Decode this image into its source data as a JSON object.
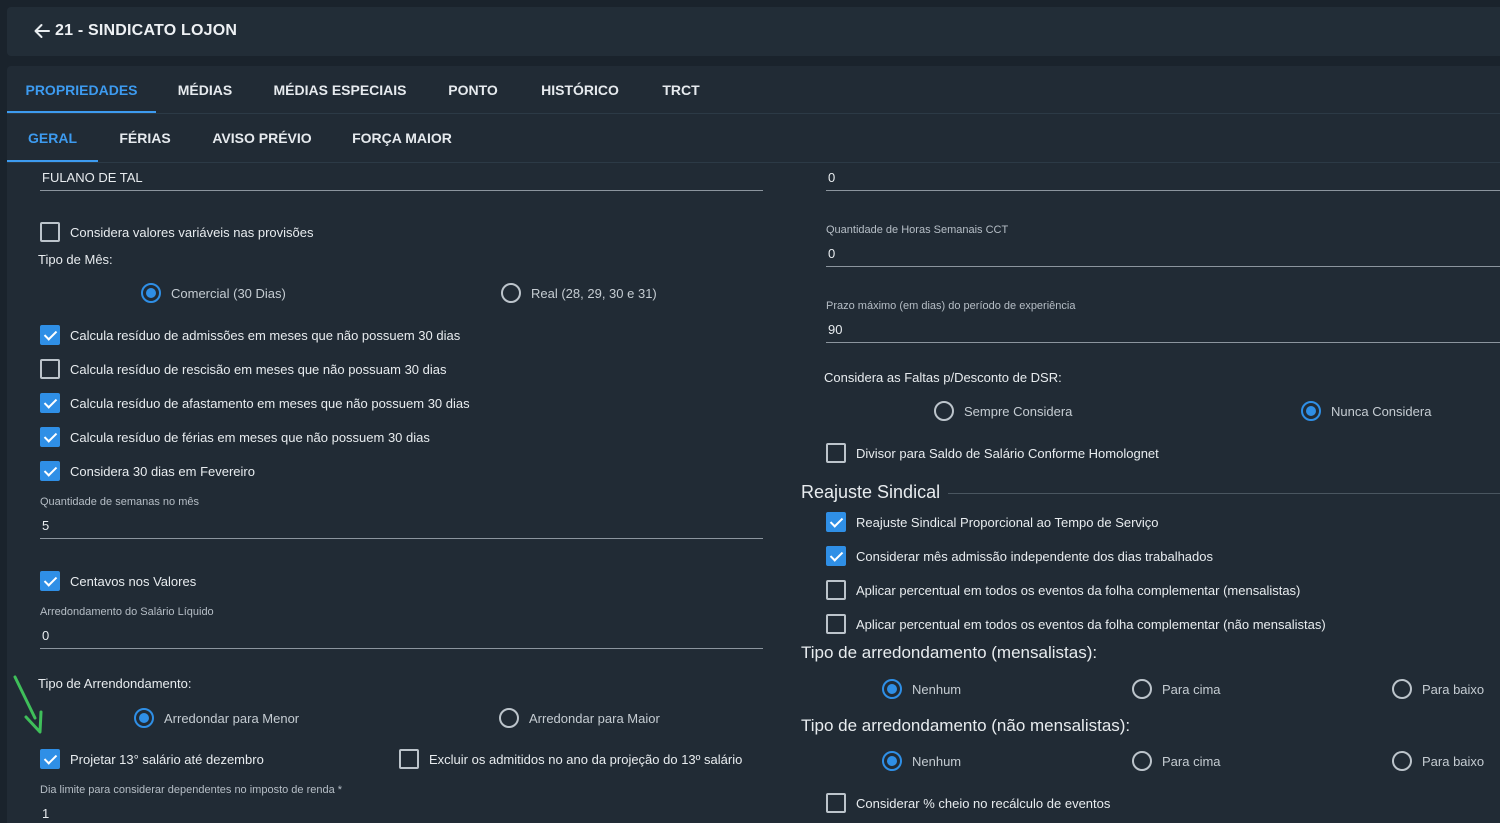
{
  "header": {
    "title": "21 - SINDICATO LOJON",
    "back_icon": "arrow-left-icon"
  },
  "tabs_primary": [
    {
      "label": "PROPRIEDADES",
      "active": true
    },
    {
      "label": "MÉDIAS",
      "active": false
    },
    {
      "label": "MÉDIAS ESPECIAIS",
      "active": false
    },
    {
      "label": "PONTO",
      "active": false
    },
    {
      "label": "HISTÓRICO",
      "active": false
    },
    {
      "label": "TRCT",
      "active": false
    }
  ],
  "tabs_secondary": [
    {
      "label": "GERAL",
      "active": true
    },
    {
      "label": "FÉRIAS",
      "active": false
    },
    {
      "label": "AVISO PRÉVIO",
      "active": false
    },
    {
      "label": "FORÇA MAIOR",
      "active": false
    }
  ],
  "left": {
    "name_field": {
      "value": "FULANO DE TAL"
    },
    "considera_variaveis": {
      "label": "Considera valores variáveis nas provisões",
      "checked": false
    },
    "tipo_mes": {
      "label": "Tipo de Mês:",
      "options": [
        {
          "label": "Comercial (30 Dias)",
          "selected": true
        },
        {
          "label": "Real (28, 29, 30 e 31)",
          "selected": false
        }
      ]
    },
    "residuo_admissoes": {
      "label": "Calcula resíduo de admissões em meses que não possuem 30 dias",
      "checked": true
    },
    "residuo_rescisao": {
      "label": "Calcula resíduo de rescisão em meses que não possuam 30 dias",
      "checked": false
    },
    "residuo_afastamento": {
      "label": "Calcula resíduo de afastamento em meses que não possuem 30 dias",
      "checked": true
    },
    "residuo_ferias": {
      "label": "Calcula resíduo de férias em meses que não possuem 30 dias",
      "checked": true
    },
    "considera_fevereiro": {
      "label": "Considera 30 dias em Fevereiro",
      "checked": true
    },
    "semanas_mes": {
      "label": "Quantidade de semanas no mês",
      "value": "5"
    },
    "centavos": {
      "label": "Centavos nos Valores",
      "checked": true
    },
    "arredondamento_salario": {
      "label": "Arredondamento do Salário Líquido",
      "value": "0"
    },
    "tipo_arredondamento": {
      "label": "Tipo de Arrendondamento:",
      "options": [
        {
          "label": "Arredondar para Menor",
          "selected": true
        },
        {
          "label": "Arredondar para Maior",
          "selected": false
        }
      ]
    },
    "projetar_13": {
      "label": "Projetar 13° salário até dezembro",
      "checked": true
    },
    "excluir_admitidos": {
      "label": "Excluir os admitidos no ano da projeção do 13º salário",
      "checked": false
    },
    "dia_limite": {
      "label": "Dia limite para considerar dependentes no imposto de renda *",
      "value": "1"
    }
  },
  "right": {
    "top_field": {
      "value": "0"
    },
    "horas_semanais": {
      "label": "Quantidade de Horas Semanais CCT",
      "value": "0"
    },
    "prazo_experiencia": {
      "label": "Prazo máximo (em dias) do período de experiência",
      "value": "90"
    },
    "faltas_dsr": {
      "label": "Considera as Faltas p/Desconto de DSR:",
      "options": [
        {
          "label": "Sempre Considera",
          "selected": false
        },
        {
          "label": "Nunca Considera",
          "selected": true
        }
      ]
    },
    "divisor_saldo": {
      "label": "Divisor para Saldo de Salário Conforme Homolognet",
      "checked": false
    },
    "reajuste_title": "Reajuste Sindical",
    "reajuste_proporcional": {
      "label": "Reajuste Sindical Proporcional ao Tempo de Serviço",
      "checked": true
    },
    "considerar_mes_admissao": {
      "label": "Considerar mês admissão independente dos dias trabalhados",
      "checked": true
    },
    "aplicar_mensalistas": {
      "label": "Aplicar percentual em todos os eventos da folha complementar (mensalistas)",
      "checked": false
    },
    "aplicar_nao_mensalistas": {
      "label": "Aplicar percentual em todos os eventos da folha complementar (não mensalistas)",
      "checked": false
    },
    "arred_mensalistas": {
      "label": "Tipo de arredondamento (mensalistas):",
      "options": [
        {
          "label": "Nenhum",
          "selected": true
        },
        {
          "label": "Para cima",
          "selected": false
        },
        {
          "label": "Para baixo",
          "selected": false
        }
      ]
    },
    "arred_nao_mensalistas": {
      "label": "Tipo de arredondamento (não mensalistas):",
      "options": [
        {
          "label": "Nenhum",
          "selected": true
        },
        {
          "label": "Para cima",
          "selected": false
        },
        {
          "label": "Para baixo",
          "selected": false
        }
      ]
    },
    "considerar_cheio": {
      "label": "Considerar % cheio no recálculo de eventos",
      "checked": false
    }
  },
  "colors": {
    "accent": "#3d9bf0",
    "annotation_arrow": "#3fbf5a",
    "background": "#1a232c",
    "card": "#212b35"
  }
}
